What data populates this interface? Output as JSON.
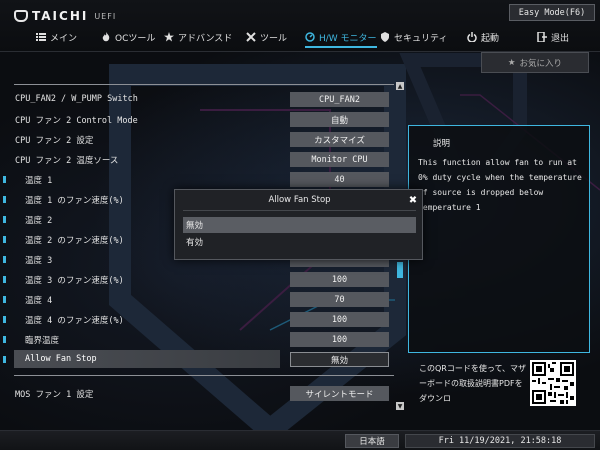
{
  "app": {
    "brand": "TAICHI",
    "brand_sub": "UEFI",
    "easy_mode_label": "Easy Mode(F6)"
  },
  "nav": [
    {
      "label": "メイン",
      "icon": "list-icon"
    },
    {
      "label": "OCツール",
      "icon": "flame-icon"
    },
    {
      "label": "アドバンスド",
      "icon": "star-icon"
    },
    {
      "label": "ツール",
      "icon": "tools-icon"
    },
    {
      "label": "H/W モニター",
      "icon": "monitor-icon",
      "active": true
    },
    {
      "label": "セキュリティ",
      "icon": "shield-icon"
    },
    {
      "label": "起動",
      "icon": "power-icon"
    },
    {
      "label": "退出",
      "icon": "exit-icon"
    }
  ],
  "favorites_label": "お気に入り",
  "settings": [
    {
      "label": "CPU_FAN2 / W_PUMP Switch",
      "value": "CPU_FAN2",
      "indent": false
    },
    {
      "label": "CPU ファン 2 Control Mode",
      "value": "自動",
      "indent": false
    },
    {
      "label": "CPU ファン 2 設定",
      "value": "カスタマイズ",
      "indent": false
    },
    {
      "label": "CPU ファン 2 温度ソース",
      "value": "Monitor CPU",
      "indent": false
    },
    {
      "label": "温度 1",
      "value": "40",
      "indent": true
    },
    {
      "label": "温度 1 のファン速度(%)",
      "value": "",
      "indent": true
    },
    {
      "label": "温度 2",
      "value": "",
      "indent": true
    },
    {
      "label": "温度 2 のファン速度(%)",
      "value": "",
      "indent": true
    },
    {
      "label": "温度 3",
      "value": "",
      "indent": true
    },
    {
      "label": "温度 3 のファン速度(%)",
      "value": "100",
      "indent": true
    },
    {
      "label": "温度 4",
      "value": "70",
      "indent": true
    },
    {
      "label": "温度 4 のファン速度(%)",
      "value": "100",
      "indent": true
    },
    {
      "label": "臨界温度",
      "value": "100",
      "indent": true
    },
    {
      "label": "Allow Fan Stop",
      "value": "無効",
      "indent": true,
      "selected": true
    }
  ],
  "settings_after": [
    {
      "label": "MOS ファン 1 設定",
      "value": "サイレントモード",
      "indent": false
    }
  ],
  "description": {
    "title": "説明",
    "text": "This function allow fan to run at 0% duty cycle when the temperature of source is dropped below temperature 1"
  },
  "qr_text": "このQRコードを使って、マザーボードの取扱説明書PDFをダウンロ",
  "modal": {
    "title": "Allow Fan Stop",
    "options": [
      {
        "label": "無効",
        "selected": true
      },
      {
        "label": "有効",
        "selected": false
      }
    ]
  },
  "footer": {
    "language": "日本語",
    "datetime": "Fri 11/19/2021, 21:58:18"
  },
  "colors": {
    "accent": "#3fb7e0",
    "background": "#0b0d11"
  }
}
